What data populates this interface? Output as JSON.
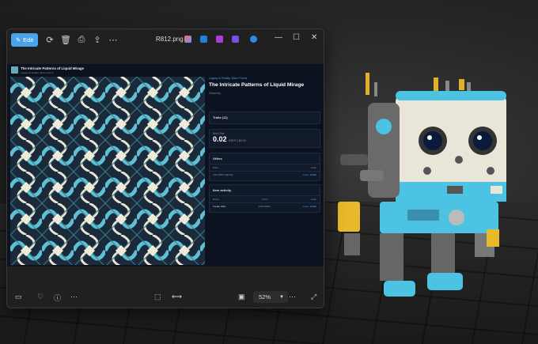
{
  "toolbar": {
    "edit_label": "Edit",
    "filename": "R812.png",
    "zoom": "52%"
  },
  "nft": {
    "collection": "The Intricate Patterns of Liquid Mirage",
    "collection_sub": "Legacy of Reality: Micro Forms",
    "panel_sub": "Legacy of Reality: Micro Forms",
    "title": "The Intricate Patterns of Liquid Mirage",
    "owners_label": "Owned by",
    "traits": "Traits (11)",
    "best_offer_label": "Best Offer",
    "best_offer_value": "0.02",
    "best_offer_unit": "RDOT | $0.00",
    "offers": "Offers",
    "offers_col_price": "Price",
    "offers_col_from": "From",
    "offer_row_price": "0.02 RDOT ($0.00)",
    "offer_row_from": "Leon..4b9ab",
    "activity": "Item activity",
    "activity_col_event": "Event",
    "activity_col_price": "Price",
    "activity_col_from": "From",
    "activity_row_event": "Create Offer",
    "activity_row_price": "0.02 RDOT",
    "activity_row_from": "Leon..4b9ab"
  },
  "colors": {
    "accent": "#4aa3e8",
    "background": "#0c1220"
  }
}
